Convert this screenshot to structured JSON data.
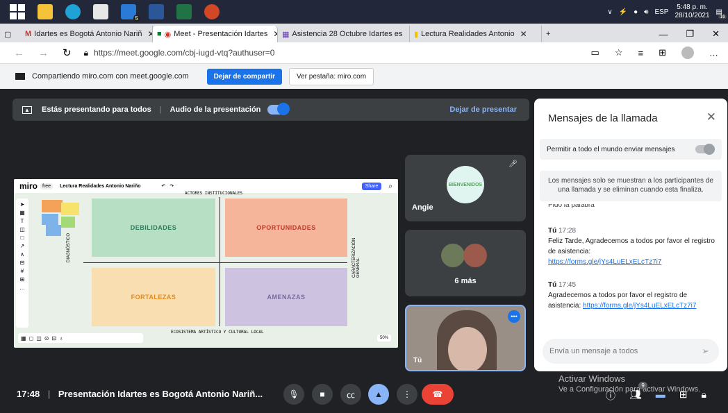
{
  "taskbar": {
    "tray": {
      "lang": "ESP",
      "time": "5:48 p. m.",
      "date": "28/10/2021",
      "notif_count": "16",
      "badge": "5"
    }
  },
  "browser": {
    "tabs": [
      {
        "label": "Idartes es Bogotá Antonio Nariñ"
      },
      {
        "label": "Meet - Presentación Idartes"
      },
      {
        "label": "Asistencia 28 Octubre Idartes es"
      },
      {
        "label": "Lectura Realidades Antonio"
      }
    ],
    "url": "https://meet.google.com/cbj-iugd-vtq?authuser=0"
  },
  "sharebar": {
    "text": "Compartiendo miro.com con meet.google.com",
    "stop": "Dejar de compartir",
    "view": "Ver pestaña: miro.com"
  },
  "presenting": {
    "text": "Estás presentando para todos",
    "audio": "Audio de la presentación",
    "stop": "Dejar de presentar"
  },
  "miro": {
    "logo": "miro",
    "plan": "free",
    "board": "Lectura Realidades Antonio Nariño",
    "share": "Share",
    "zoom": "50%",
    "top_axis": "ACTORES INSTITUCIONALES",
    "bottom_axis": "ECOSISTEMA ARTÍSTICO Y CULTURAL LOCAL",
    "left_axis": "DIAGNÓSTICO",
    "right_axis": "CARACTERIZACIÓN GENERAL",
    "quadrants": {
      "d": "DEBILIDADES",
      "o": "OPORTUNIDADES",
      "f": "FORTALEZAS",
      "a": "AMENAZAS"
    }
  },
  "tiles": {
    "angie": "Angie",
    "bienvenidos": "BIENVENIDOS",
    "more": "6 más",
    "me": "Tú"
  },
  "chat": {
    "title": "Mensajes de la llamada",
    "allow": "Permitir a todo el mundo enviar mensajes",
    "notice": "Los mensajes solo se muestran a los participantes de una llamada y se eliminan cuando esta finaliza.",
    "partial": "Pido la palabra",
    "messages": [
      {
        "author": "Tú",
        "time": "17:28",
        "text": "Feliz Tarde, Agradecemos a todos por favor el registro de asistencia:",
        "link": "https://forms.gle/jYs4LuELxELcTz7i7"
      },
      {
        "author": "Tú",
        "time": "17:45",
        "text": "Agradecemos a todos por favor el registro de asistencia:",
        "link": "https://forms.gle/jYs4LuELxELcTz7i7"
      }
    ],
    "placeholder": "Envía un mensaje a todos"
  },
  "bottom": {
    "time": "17:48",
    "title": "Presentación Idartes es Bogotá Antonio Nariñ...",
    "people_count": "9"
  },
  "watermark": {
    "line1": "Activar Windows",
    "line2": "Ve a Configuración para activar Windows."
  }
}
